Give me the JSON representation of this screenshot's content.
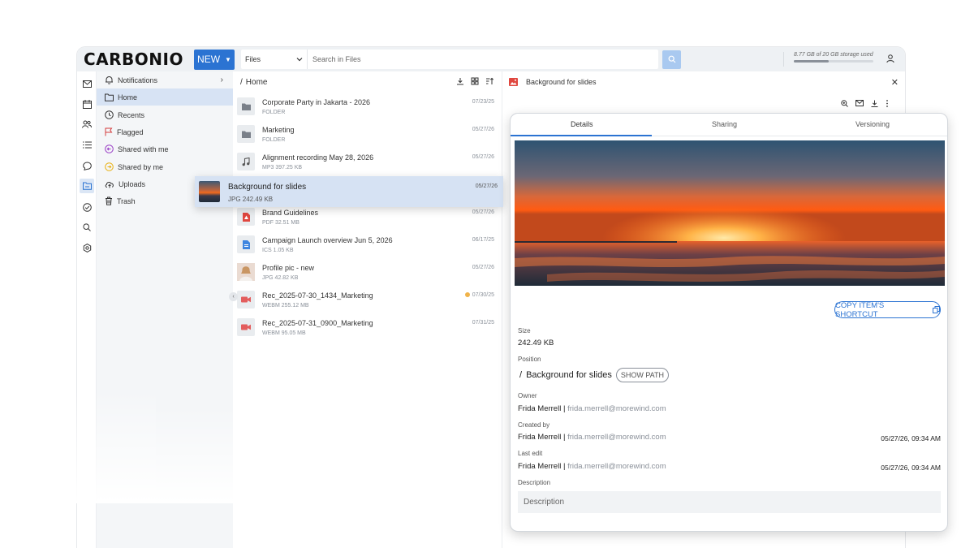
{
  "app": {
    "logo": "CARBONIO",
    "new_label": "NEW",
    "search_scope": "Files",
    "search_placeholder": "Search in Files",
    "storage_text": "8.77 GB of 20 GB storage used",
    "storage_used_gb": 8.77,
    "storage_total_gb": 20,
    "accent_color": "#2b73d2"
  },
  "nav": {
    "items": [
      {
        "label": "Notifications",
        "icon": "bell-icon"
      },
      {
        "label": "Home",
        "icon": "folder-icon"
      },
      {
        "label": "Recents",
        "icon": "clock-icon"
      },
      {
        "label": "Flagged",
        "icon": "flag-icon"
      },
      {
        "label": "Shared with me",
        "icon": "shared-in-icon"
      },
      {
        "label": "Shared by me",
        "icon": "shared-out-icon"
      },
      {
        "label": "Uploads",
        "icon": "cloud-upload-icon"
      },
      {
        "label": "Trash",
        "icon": "trash-icon"
      }
    ]
  },
  "list": {
    "breadcrumb_sep": "/",
    "breadcrumb": "Home",
    "files": [
      {
        "name": "Corporate Party in Jakarta - 2026",
        "meta": "FOLDER",
        "date": "07/23/25",
        "icon": "folder-icon"
      },
      {
        "name": "Marketing",
        "meta": "FOLDER",
        "date": "05/27/26",
        "icon": "folder-icon"
      },
      {
        "name": "Alignment recording May 28, 2026",
        "meta": "MP3   397.25 KB",
        "date": "05/27/26",
        "icon": "music-note-icon"
      },
      {
        "name": "Brand Guidelines",
        "meta": "PDF   32.51 MB",
        "date": "05/27/26",
        "icon": "pdf-icon"
      },
      {
        "name": "Campaign Launch overview Jun 5, 2026",
        "meta": "ICS   1.05 KB",
        "date": "06/17/25",
        "icon": "document-icon"
      },
      {
        "name": "Profile pic - new",
        "meta": "JPG   42.82 KB",
        "date": "05/27/26",
        "icon": "photo-thumb"
      },
      {
        "name": "Rec_2025-07-30_1434_Marketing",
        "meta": "WEBM   255.12 MB",
        "date": "07/30/25",
        "icon": "video-icon"
      },
      {
        "name": "Rec_2025-07-31_0900_Marketing",
        "meta": "WEBM   95.05 MB",
        "date": "07/31/25",
        "icon": "video-icon"
      }
    ],
    "dragged": {
      "name": "Background for slides",
      "meta": "JPG   242.49 KB",
      "date": "05/27/26"
    }
  },
  "preview": {
    "title": "Background for slides",
    "tabs": [
      "Details",
      "Sharing",
      "Versioning"
    ],
    "copy_label": "COPY ITEM'S SHORTCUT",
    "size_label": "Size",
    "size_value": "242.49 KB",
    "position_label": "Position",
    "position_sep": "/",
    "position_value": "Background for slides",
    "show_path": "SHOW PATH",
    "owner_label": "Owner",
    "owner_name": "Frida Merrell",
    "owner_email": "frida.merrell@morewind.com",
    "created_label": "Created by",
    "created_name": "Frida Merrell",
    "created_email": "frida.merrell@morewind.com",
    "created_date": "05/27/26, 09:34 AM",
    "edit_label": "Last edit",
    "edit_name": "Frida Merrell",
    "edit_email": "frida.merrell@morewind.com",
    "edit_date": "05/27/26, 09:34 AM",
    "description_label": "Description",
    "description_placeholder": "Description"
  }
}
